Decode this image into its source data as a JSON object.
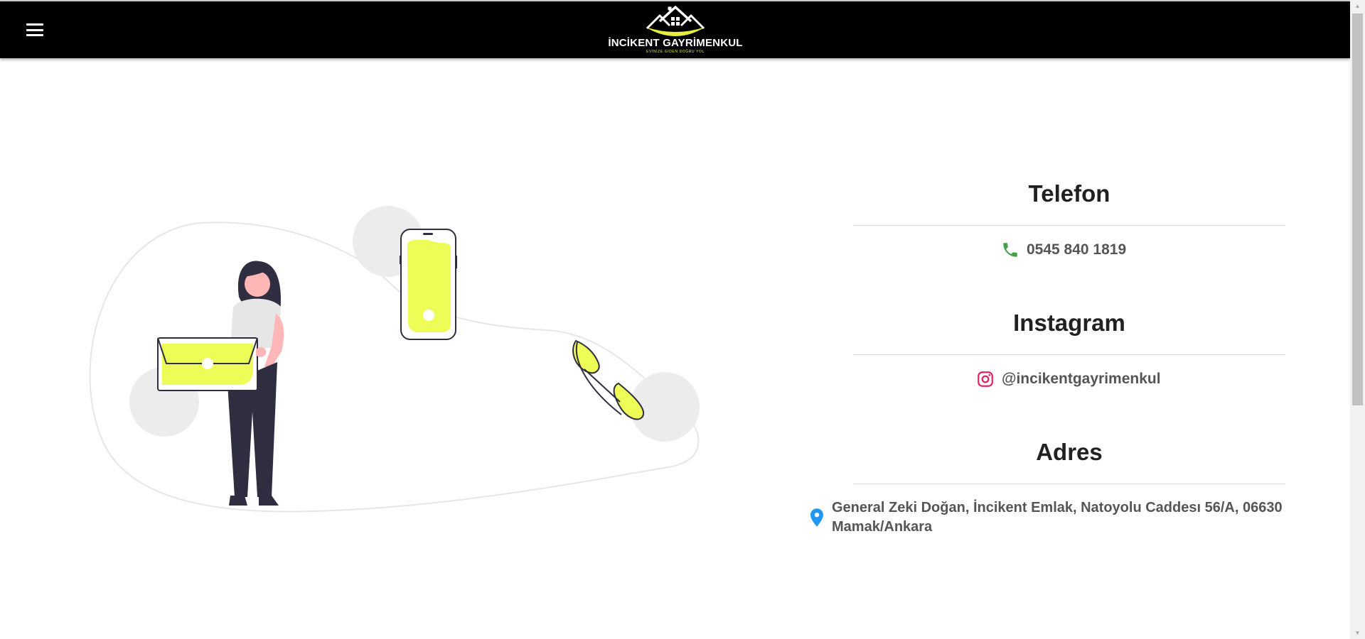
{
  "header": {
    "menu_icon": "hamburger-menu-icon",
    "brand_name": "İNCİKENT GAYRİMENKUL",
    "brand_tagline": "EVİNİZE GİDEN DOĞRU YOL",
    "logo_icon": "house-roofs-logo-icon",
    "accent_color": "#e5ee3e"
  },
  "contact": {
    "phone": {
      "title": "Telefon",
      "value": "0545 840 1819",
      "icon": "phone-icon",
      "icon_color": "#43a047"
    },
    "instagram": {
      "title": "Instagram",
      "value": "@incikentgayrimenkul",
      "icon": "instagram-icon",
      "icon_color": "#e91e63"
    },
    "address": {
      "title": "Adres",
      "value": "General Zeki Doğan, İncikent Emlak, Natoyolu Caddesı 56/A, 06630 Mamak/Ankara",
      "icon": "location-pin-icon",
      "icon_color": "#2196f3"
    }
  },
  "illustration": {
    "description_icon": "contact-us-illustration",
    "accent_color": "#eefc57"
  }
}
